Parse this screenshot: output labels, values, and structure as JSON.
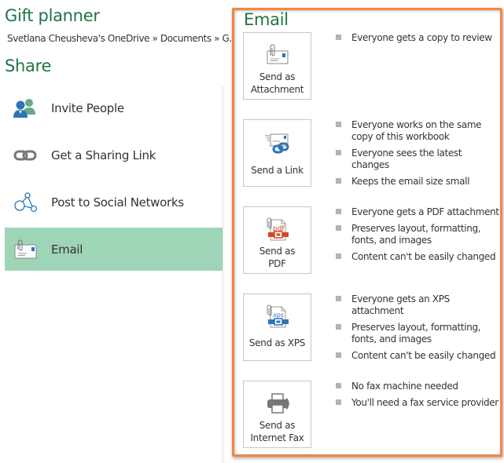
{
  "document": {
    "title": "Gift planner",
    "breadcrumb": "Svetlana Cheusheva's OneDrive » Documents » G..."
  },
  "share": {
    "title": "Share",
    "items": [
      {
        "label": "Invite People",
        "icon": "invite-people-icon"
      },
      {
        "label": "Get a Sharing Link",
        "icon": "sharing-link-icon"
      },
      {
        "label": "Post to Social Networks",
        "icon": "social-networks-icon"
      },
      {
        "label": "Email",
        "icon": "email-icon",
        "selected": true
      }
    ]
  },
  "email": {
    "title": "Email",
    "options": [
      {
        "label_lines": [
          "Send as",
          "Attachment"
        ],
        "icon": "email-attachment-icon",
        "bullets": [
          "Everyone gets a copy to review"
        ]
      },
      {
        "label_lines": [
          "Send a Link"
        ],
        "icon": "email-link-icon",
        "bullets": [
          "Everyone works on the same copy of this workbook",
          "Everyone sees the latest changes",
          "Keeps the email size small"
        ]
      },
      {
        "label_lines": [
          "Send as",
          "PDF"
        ],
        "icon": "pdf-icon",
        "bullets": [
          "Everyone gets a PDF attachment",
          "Preserves layout, formatting, fonts, and images",
          "Content can't be easily changed"
        ]
      },
      {
        "label_lines": [
          "Send as XPS"
        ],
        "icon": "xps-icon",
        "bullets": [
          "Everyone gets an XPS attachment",
          "Preserves layout, formatting, fonts, and images",
          "Content can't be easily changed"
        ]
      },
      {
        "label_lines": [
          "Send as",
          "Internet Fax"
        ],
        "icon": "fax-icon",
        "bullets": [
          "No fax machine needed",
          "You'll need a fax service provider"
        ]
      }
    ]
  },
  "colors": {
    "accent_green": "#217346",
    "selected_bg": "#9fd5b7",
    "highlight_border": "#f58542"
  }
}
